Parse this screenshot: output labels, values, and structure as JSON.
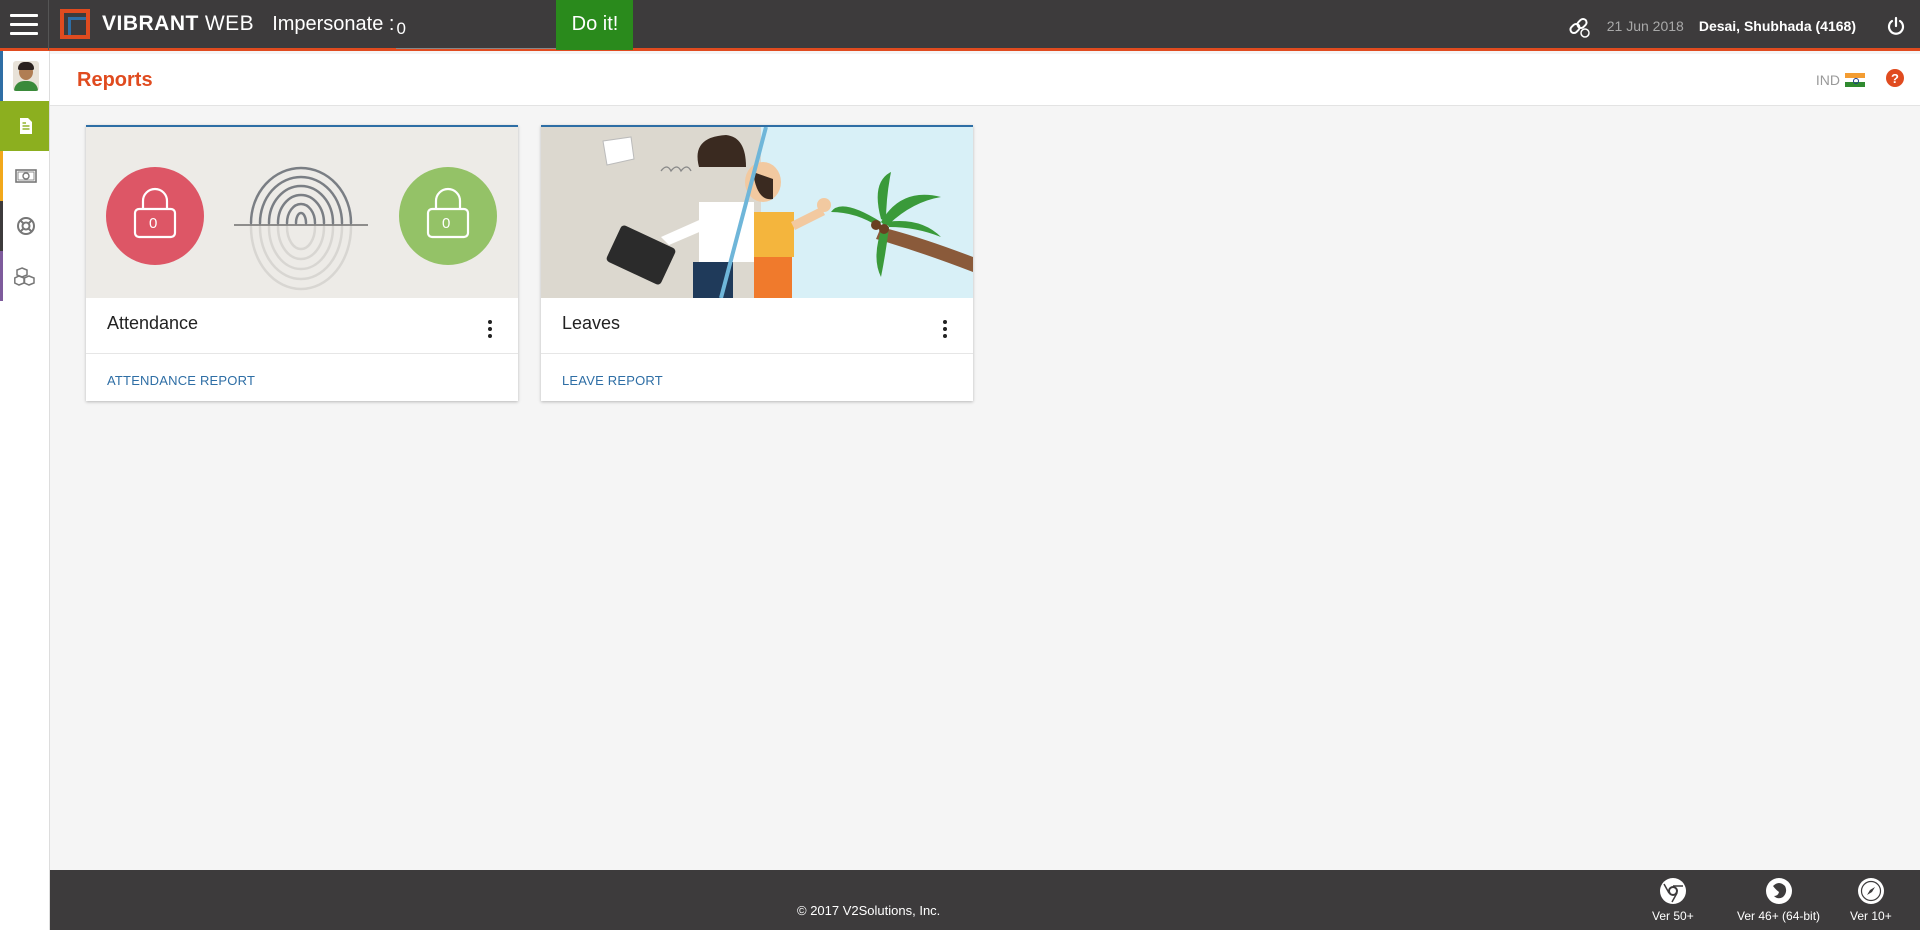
{
  "topbar": {
    "brand_strong": "VIBRANT",
    "brand_light": "WEB",
    "impersonate_label": "Impersonate :",
    "impersonate_value": "0",
    "doit_label": "Do it!",
    "date": "21 Jun 2018",
    "user": "Desai, Shubhada (4168)"
  },
  "sidenav": {
    "items": [
      {
        "name": "profile",
        "icon": "avatar"
      },
      {
        "name": "reports",
        "icon": "document-icon",
        "active": true
      },
      {
        "name": "salary",
        "icon": "money-icon"
      },
      {
        "name": "help",
        "icon": "lifebuoy-icon"
      },
      {
        "name": "apps",
        "icon": "cubes-icon"
      }
    ]
  },
  "page": {
    "title": "Reports",
    "locale": "IND"
  },
  "cards": [
    {
      "title": "Attendance",
      "link": "ATTENDANCE REPORT",
      "lock_left_value": "0",
      "lock_right_value": "0"
    },
    {
      "title": "Leaves",
      "link": "LEAVE REPORT"
    }
  ],
  "footer": {
    "copyright": "© 2017 V2Solutions, Inc.",
    "browsers": [
      {
        "name": "chrome-icon",
        "label": "Ver 50+"
      },
      {
        "name": "firefox-icon",
        "label": "Ver 46+ (64-bit)"
      },
      {
        "name": "safari-icon",
        "label": "Ver 10+"
      }
    ]
  },
  "colors": {
    "topbar": "#3d3b3c",
    "accent": "#e04b1f",
    "link": "#2e6ea5",
    "active_nav": "#8caf1f",
    "doit": "#2a8a1c"
  }
}
